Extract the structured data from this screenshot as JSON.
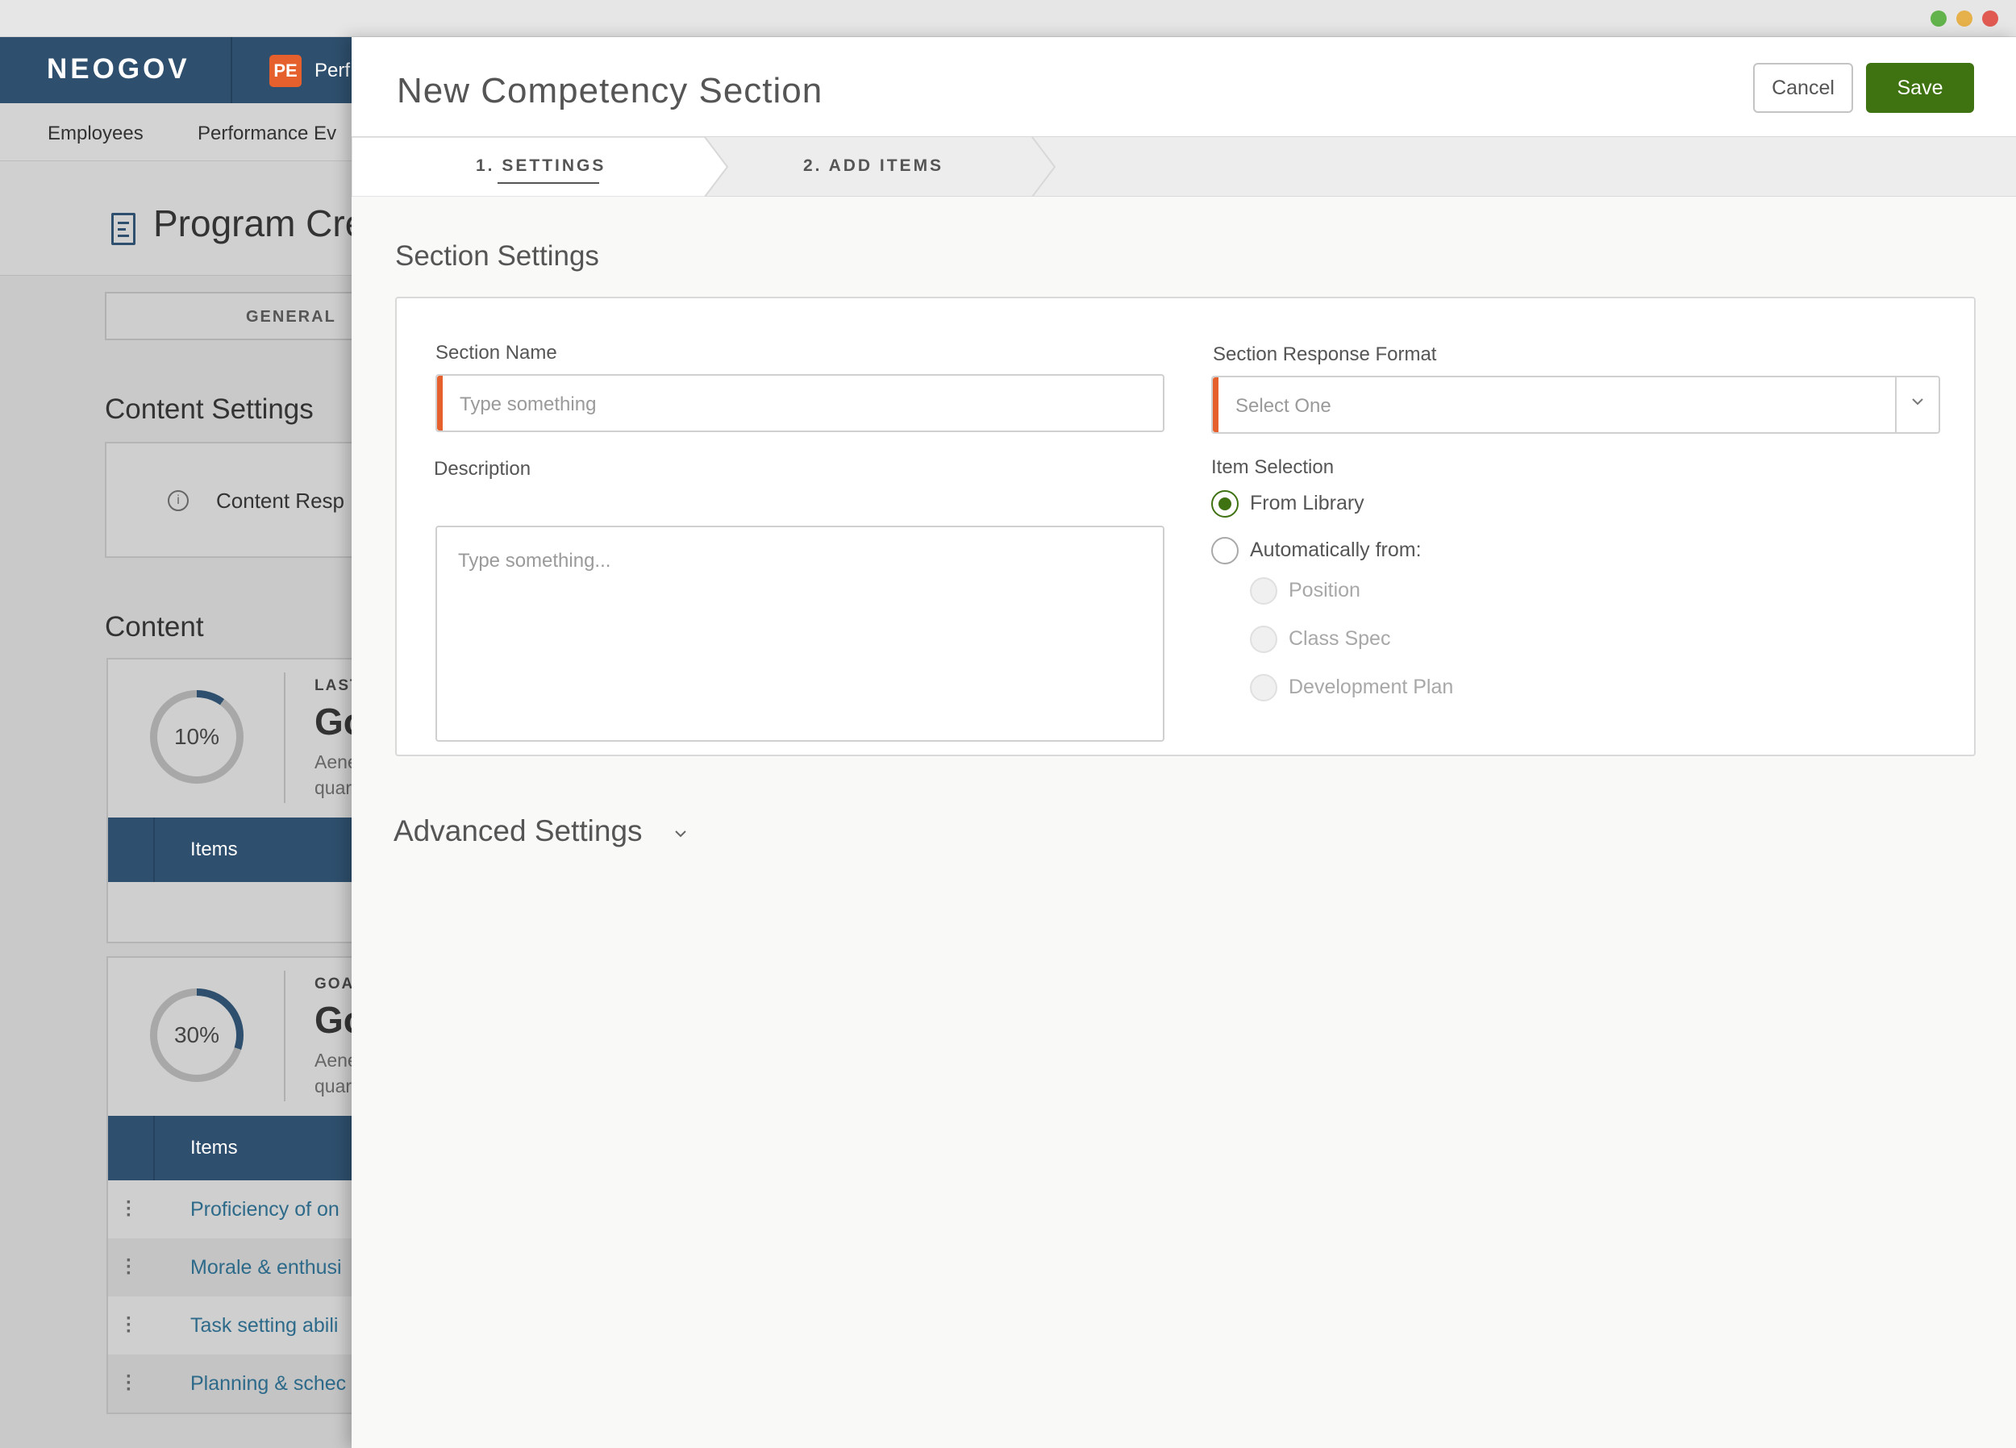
{
  "window": {
    "controls": [
      "minimize",
      "maximize",
      "close"
    ]
  },
  "background_app": {
    "logo": "NEOGOV",
    "product_badge": "PE",
    "product_name": "Perf",
    "nav": [
      "Employees",
      "Performance Ev"
    ],
    "page_title": "Program Cre",
    "tab_general": "GENERAL",
    "content_settings_title": "Content Settings",
    "content_response_label": "Content Resp",
    "content_title": "Content",
    "cards": [
      {
        "progress": 10,
        "progress_label": "10%",
        "label": "LAST",
        "heading": "Go",
        "text": [
          "Aene",
          "quar"
        ],
        "items_label": "Items"
      },
      {
        "progress": 30,
        "progress_label": "30%",
        "label": "GOA",
        "heading": "Go",
        "text": [
          "Aene",
          "quar"
        ],
        "items_label": "Items",
        "rows": [
          "Proficiency of on",
          "Morale & enthusi",
          "Task setting abili",
          "Planning & schec"
        ]
      }
    ]
  },
  "panel": {
    "title": "New Competency Section",
    "cancel_label": "Cancel",
    "save_label": "Save",
    "steps": [
      {
        "label": "1. SETTINGS",
        "active": true
      },
      {
        "label": "2. ADD ITEMS",
        "active": false
      }
    ],
    "section_settings_title": "Section Settings",
    "section_name": {
      "label": "Section Name",
      "value": "",
      "placeholder": "Type something"
    },
    "description": {
      "label": "Description",
      "value": "",
      "placeholder": "Type something..."
    },
    "response_format": {
      "label": "Section Response Format",
      "selected": "Select One"
    },
    "item_selection": {
      "label": "Item Selection",
      "options": [
        {
          "label": "From Library",
          "selected": true
        },
        {
          "label": "Automatically from:",
          "selected": false
        }
      ],
      "sub_options": [
        "Position",
        "Class Spec",
        "Development Plan"
      ]
    },
    "advanced_settings_title": "Advanced Settings"
  },
  "colors": {
    "brand_navy": "#2e4f6d",
    "save_green": "#3f7211",
    "required_orange": "#e5602c",
    "link_blue": "#2d6a8a"
  },
  "icons": [
    "document-icon",
    "info-icon",
    "kebab-icon",
    "chevron-down-icon",
    "chevron-down-icon"
  ]
}
